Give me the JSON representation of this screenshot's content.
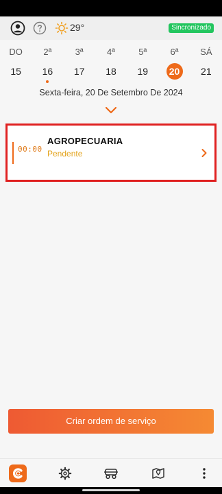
{
  "header": {
    "weather_temp": "29°",
    "sync_status": "Sincronizado",
    "icons": [
      "profile-icon",
      "help-icon",
      "sun-icon"
    ]
  },
  "calendar": {
    "days": [
      {
        "name": "DO",
        "number": "15"
      },
      {
        "name": "2ª",
        "number": "16",
        "has_event": true
      },
      {
        "name": "3ª",
        "number": "17"
      },
      {
        "name": "4ª",
        "number": "18"
      },
      {
        "name": "5ª",
        "number": "19"
      },
      {
        "name": "6ª",
        "number": "20",
        "selected": true
      },
      {
        "name": "SÁ",
        "number": "21"
      }
    ],
    "selected_date_label": "Sexta-feira, 20 De Setembro De 2024"
  },
  "appointment": {
    "time": "00:00",
    "title": "AGROPECUARIA",
    "status": "Pendente"
  },
  "actions": {
    "create_order_label": "Criar ordem de serviço"
  },
  "bottom_nav": {
    "icons": [
      "app-logo-icon",
      "settings-gear-icon",
      "vehicle-icon",
      "map-pin-icon",
      "more-vertical-icon"
    ]
  },
  "colors": {
    "accent": "#ee6a1a",
    "status_pending": "#e3a21a",
    "sync_badge": "#22c55e",
    "highlight_border": "#e02020"
  }
}
